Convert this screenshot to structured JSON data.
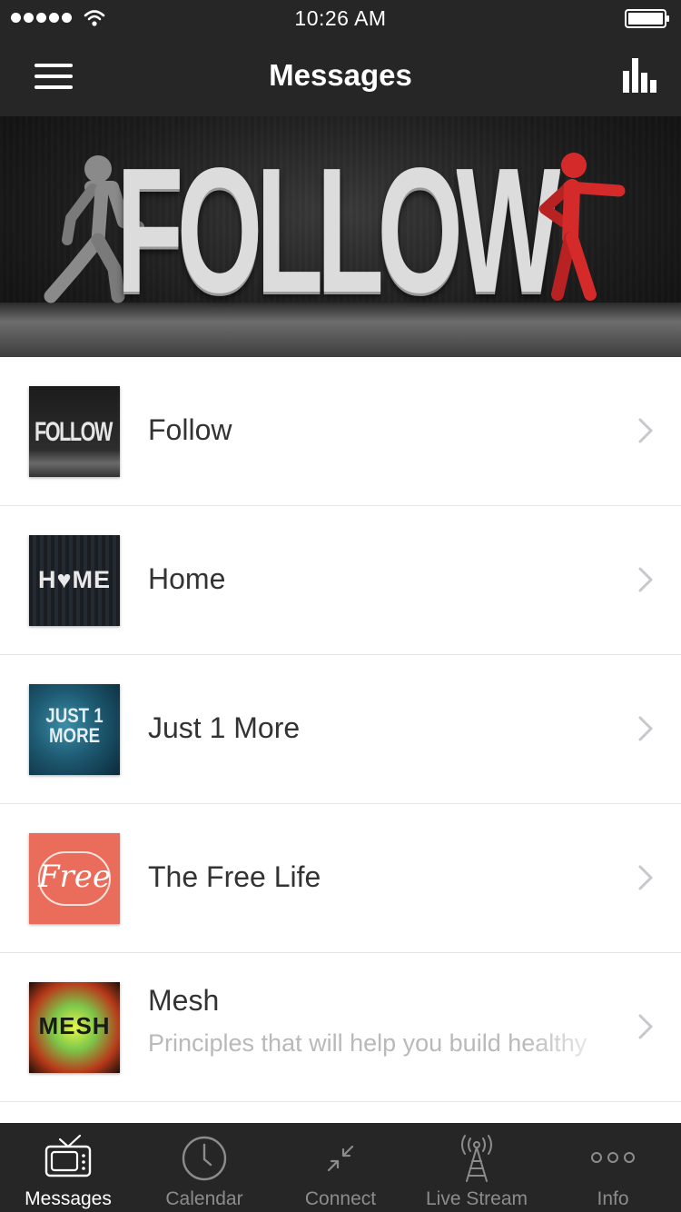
{
  "status_bar": {
    "time": "10:26 AM",
    "signal_icon": "signal-dots-icon",
    "wifi_icon": "wifi-icon",
    "battery_icon": "battery-icon"
  },
  "nav_bar": {
    "title": "Messages",
    "left_icon": "hamburger-menu-icon",
    "right_icon": "bar-chart-icon"
  },
  "banner": {
    "text": "FOLLOW"
  },
  "messages": [
    {
      "title": "Follow",
      "thumb_text": "FOLLOW",
      "subtitle": ""
    },
    {
      "title": "Home",
      "thumb_text": "H♥ME",
      "subtitle": ""
    },
    {
      "title": "Just 1 More",
      "thumb_text": "JUST 1 MORE",
      "subtitle": ""
    },
    {
      "title": "The Free Life",
      "thumb_text": "Free",
      "subtitle": ""
    },
    {
      "title": "Mesh",
      "thumb_text": "MESH",
      "subtitle": "Principles that will help you build healthy"
    }
  ],
  "tab_bar": {
    "tabs": [
      {
        "label": "Messages",
        "icon": "tv-icon",
        "active": true
      },
      {
        "label": "Calendar",
        "icon": "clock-icon",
        "active": false
      },
      {
        "label": "Connect",
        "icon": "connect-arrows-icon",
        "active": false
      },
      {
        "label": "Live Stream",
        "icon": "antenna-icon",
        "active": false
      },
      {
        "label": "Info",
        "icon": "more-dots-icon",
        "active": false
      }
    ]
  },
  "colors": {
    "bar_background": "#262626",
    "active_tab": "#ffffff",
    "inactive_tab": "#8c8c8c",
    "banner_accent": "#d42a2a"
  }
}
